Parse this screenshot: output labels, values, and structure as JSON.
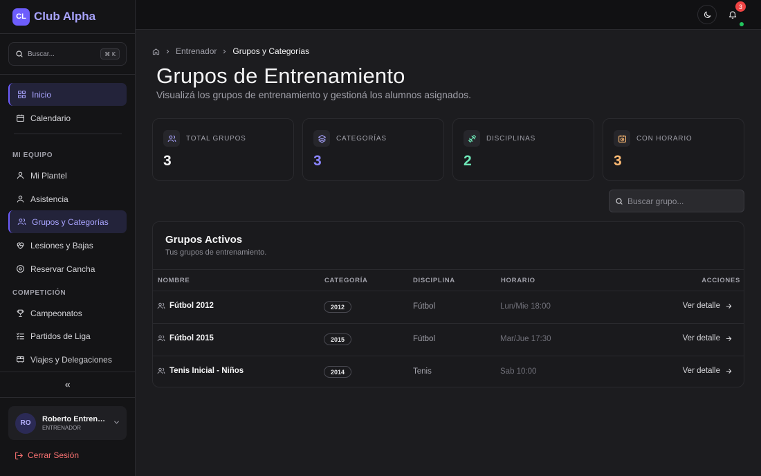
{
  "brand": {
    "logo": "CL",
    "name": "Club Alpha",
    "accent": "#6d5dfc"
  },
  "sidebar": {
    "search": {
      "placeholder": "Buscar...",
      "shortcut": "⌘ K"
    },
    "main_items": [
      {
        "label": "Inicio",
        "icon": "grid-icon",
        "active": true
      },
      {
        "label": "Calendario",
        "icon": "calendar-icon"
      }
    ],
    "sections": [
      {
        "label": "MI EQUIPO",
        "items": [
          {
            "label": "Mi Plantel",
            "icon": "users-icon"
          },
          {
            "label": "Asistencia",
            "icon": "user-check-icon"
          },
          {
            "label": "Grupos y Categorías",
            "icon": "users-icon",
            "active": true
          },
          {
            "label": "Lesiones y Bajas",
            "icon": "heart-pulse-icon"
          },
          {
            "label": "Reservar Cancha",
            "icon": "target-icon"
          }
        ]
      },
      {
        "label": "COMPETICIÓN",
        "items": [
          {
            "label": "Campeonatos",
            "icon": "trophy-icon"
          },
          {
            "label": "Partidos de Liga",
            "icon": "list-check-icon"
          },
          {
            "label": "Viajes y Delegaciones",
            "icon": "bus-icon"
          }
        ]
      }
    ],
    "user": {
      "initials": "RO",
      "name": "Roberto Entrenador",
      "role": "ENTRENADOR"
    },
    "logout_label": "Cerrar Sesión"
  },
  "topbar": {
    "notifications_count": "3"
  },
  "breadcrumb": {
    "items": [
      "Entrenador",
      "Grupos y Categorías"
    ]
  },
  "page": {
    "title": "Grupos de Entrenamiento",
    "subtitle": "Visualizá los grupos de entrenamiento y gestioná los alumnos asignados."
  },
  "stats": [
    {
      "label": "TOTAL GRUPOS",
      "value": "3",
      "color": "#f4f4f5",
      "icon": "users-icon"
    },
    {
      "label": "CATEGORÍAS",
      "value": "3",
      "color": "#8b85ff",
      "icon": "layers-icon"
    },
    {
      "label": "DISCIPLINAS",
      "value": "2",
      "color": "#6ee7b7",
      "icon": "dumbbell-icon"
    },
    {
      "label": "CON HORARIO",
      "value": "3",
      "color": "#fdba74",
      "icon": "calendar-clock-icon"
    }
  ],
  "group_search": {
    "placeholder": "Buscar grupo..."
  },
  "groups_table": {
    "title": "Grupos Activos",
    "subtitle": "Tus grupos de entrenamiento.",
    "columns": [
      "NOMBRE",
      "CATEGORÍA",
      "DISCIPLINA",
      "HORARIO",
      "ACCIONES"
    ],
    "rows": [
      {
        "name": "Fútbol 2012",
        "category": "2012",
        "discipline": "Fútbol",
        "schedule": "Lun/Mie 18:00",
        "action": "Ver detalle"
      },
      {
        "name": "Fútbol 2015",
        "category": "2015",
        "discipline": "Fútbol",
        "schedule": "Mar/Jue 17:30",
        "action": "Ver detalle"
      },
      {
        "name": "Tenis Inicial - Niños",
        "category": "2014",
        "discipline": "Tenis",
        "schedule": "Sab 10:00",
        "action": "Ver detalle"
      }
    ]
  }
}
